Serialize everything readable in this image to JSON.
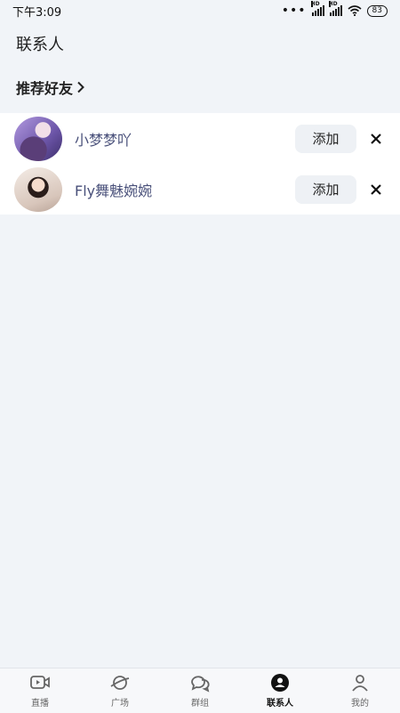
{
  "status_bar": {
    "time": "下午3:09",
    "battery": "83"
  },
  "page": {
    "title": "联系人"
  },
  "recommend": {
    "title": "推荐好友"
  },
  "friends": [
    {
      "name": "小梦梦吖",
      "add_label": "添加"
    },
    {
      "name": "Fly舞魅婉婉",
      "add_label": "添加"
    }
  ],
  "tabs": [
    {
      "label": "直播",
      "icon": "video-icon"
    },
    {
      "label": "广场",
      "icon": "planet-icon"
    },
    {
      "label": "群组",
      "icon": "chat-bubbles-icon"
    },
    {
      "label": "联系人",
      "icon": "contacts-icon",
      "active": true
    },
    {
      "label": "我的",
      "icon": "profile-icon"
    }
  ],
  "colors": {
    "background": "#f1f4f8",
    "name_text": "#49507a",
    "button_bg": "#eef1f5"
  }
}
